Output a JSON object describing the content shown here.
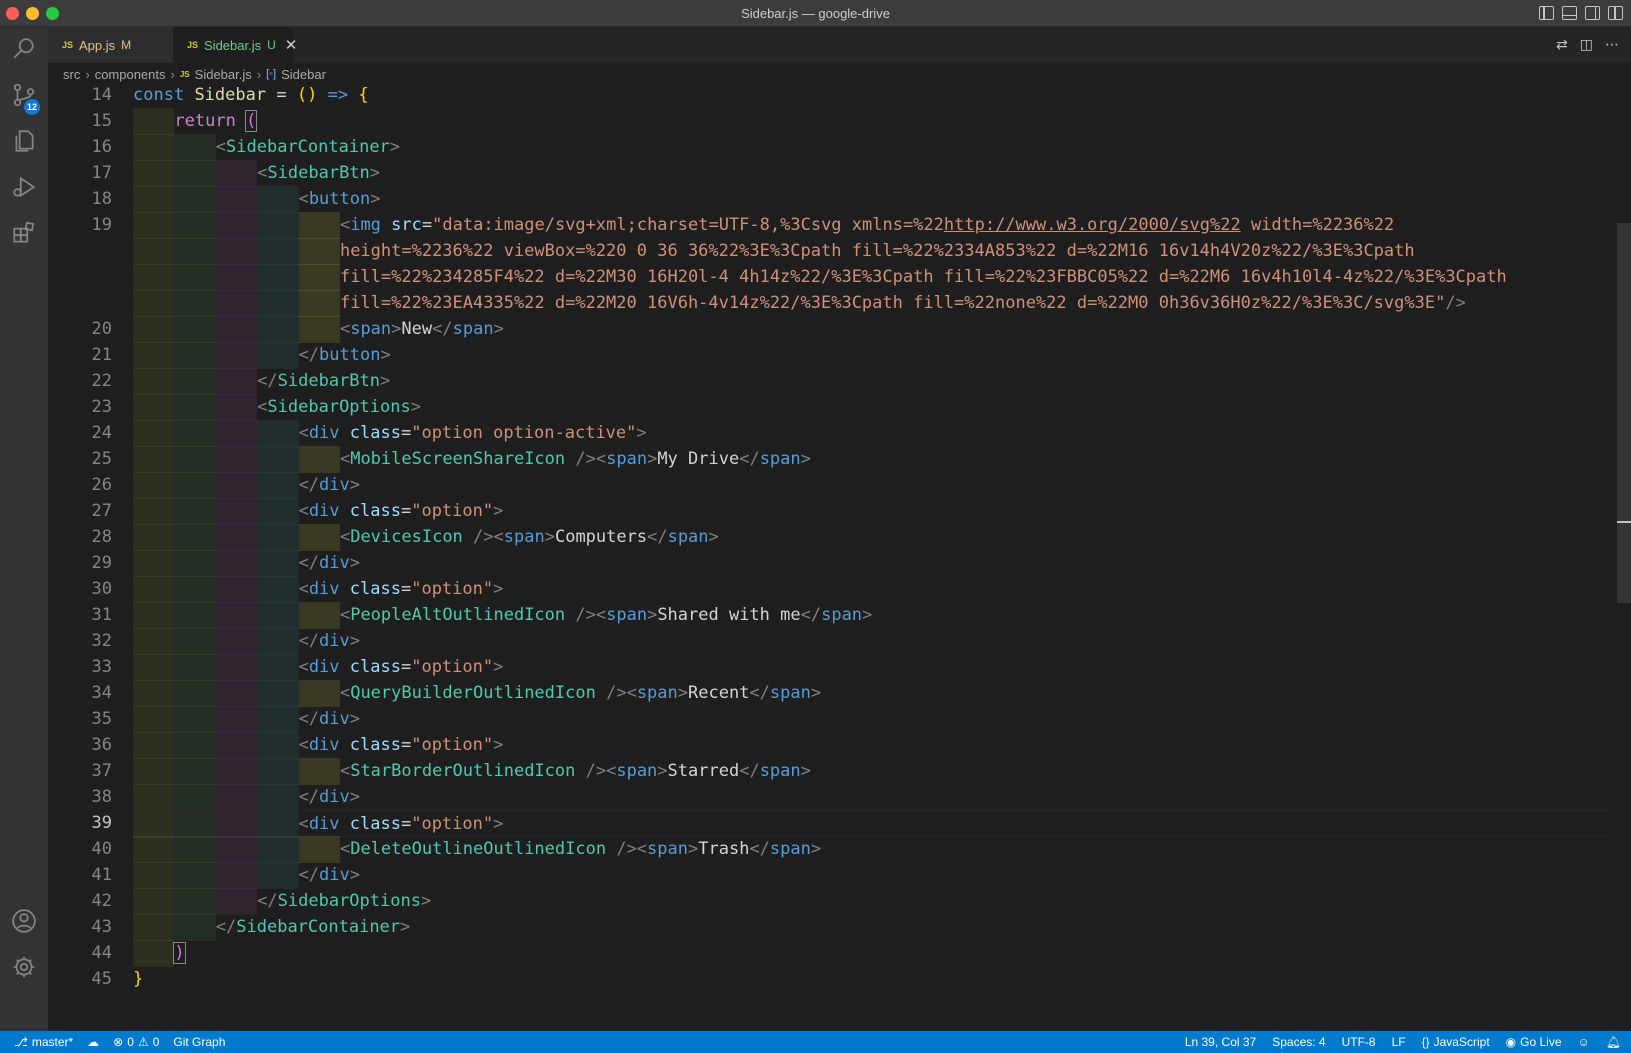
{
  "window": {
    "title": "Sidebar.js — google-drive"
  },
  "tabs": [
    {
      "label": "App.js",
      "status": "M",
      "lang": "JS"
    },
    {
      "label": "Sidebar.js",
      "status": "U",
      "lang": "JS"
    }
  ],
  "breadcrumbs": {
    "folder1": "src",
    "folder2": "components",
    "file": "Sidebar.js",
    "symbol": "Sidebar"
  },
  "activitybar": {
    "scm_badge": "12"
  },
  "editor": {
    "current_line": 39,
    "lines": [
      {
        "n": 14
      },
      {
        "n": 15
      },
      {
        "n": 16
      },
      {
        "n": 17
      },
      {
        "n": 18
      },
      {
        "n": 19
      },
      {
        "n": 20
      },
      {
        "n": 21
      },
      {
        "n": 22
      },
      {
        "n": 23
      },
      {
        "n": 24
      },
      {
        "n": 25
      },
      {
        "n": 26
      },
      {
        "n": 27
      },
      {
        "n": 28
      },
      {
        "n": 29
      },
      {
        "n": 30
      },
      {
        "n": 31
      },
      {
        "n": 32
      },
      {
        "n": 33
      },
      {
        "n": 34
      },
      {
        "n": 35
      },
      {
        "n": 36
      },
      {
        "n": 37
      },
      {
        "n": 38
      },
      {
        "n": 39
      },
      {
        "n": 40
      },
      {
        "n": 41
      },
      {
        "n": 42
      },
      {
        "n": 43
      },
      {
        "n": 44
      },
      {
        "n": 45
      }
    ],
    "code": {
      "l14": {
        "const": "const",
        "name": "Sidebar",
        "eq": "=",
        "paren": "()",
        "arrow": "=>",
        "brace": "{"
      },
      "l15": {
        "kw": "return",
        "paren": "("
      },
      "l16": {
        "tag": "SidebarContainer"
      },
      "l17": {
        "tag": "SidebarBtn"
      },
      "l18": {
        "tag": "button"
      },
      "l19": {
        "tag": "img",
        "attr": "src",
        "str_a": "\"data:image/svg+xml;charset=UTF-8,%3Csvg xmlns=%22",
        "url": "http://www.w3.org/2000/svg%22",
        "str_b": " width=%2236%22",
        "wrap1": "height=%2236%22 viewBox=%220 0 36 36%22%3E%3Cpath fill=%22%2334A853%22 d=%22M16 16v14h4V20z%22/%3E%3Cpath",
        "wrap2": "fill=%22%234285F4%22 d=%22M30 16H20l-4 4h14z%22/%3E%3Cpath fill=%22%23FBBC05%22 d=%22M6 16v4h10l4-4z%22/%3E%3Cpath",
        "wrap3": "fill=%22%23EA4335%22 d=%22M20 16V6h-4v14z%22/%3E%3Cpath fill=%22none%22 d=%22M0 0h36v36H0z%22/%3E%3C/svg%3E\""
      },
      "l20": {
        "text": "New"
      },
      "l23": {
        "tag": "SidebarOptions"
      },
      "options": [
        {
          "class": "\"option option-active\"",
          "icon": "MobileScreenShareIcon",
          "text": "My Drive"
        },
        {
          "class": "\"option\"",
          "icon": "DevicesIcon",
          "text": "Computers"
        },
        {
          "class": "\"option\"",
          "icon": "PeopleAltOutlinedIcon",
          "text": "Shared with me"
        },
        {
          "class": "\"option\"",
          "icon": "QueryBuilderOutlinedIcon",
          "text": "Recent"
        },
        {
          "class": "\"option\"",
          "icon": "StarBorderOutlinedIcon",
          "text": "Starred"
        },
        {
          "class": "\"option\"",
          "icon": "DeleteOutlineOutlinedIcon",
          "text": "Trash"
        }
      ],
      "div": "div",
      "span": "span",
      "class_attr": "class",
      "button": "button",
      "l44": {
        "paren": ")"
      },
      "l45": {
        "brace": "}"
      }
    }
  },
  "statusbar": {
    "branch": "master*",
    "errors": "0",
    "warnings": "0",
    "git_graph": "Git Graph",
    "position": "Ln 39, Col 37",
    "spaces": "Spaces: 4",
    "encoding": "UTF-8",
    "eol": "LF",
    "language": "JavaScript",
    "go_live": "Go Live"
  },
  "colors": {
    "accent": "#007acc",
    "editor_bg": "#1e1e1e"
  }
}
